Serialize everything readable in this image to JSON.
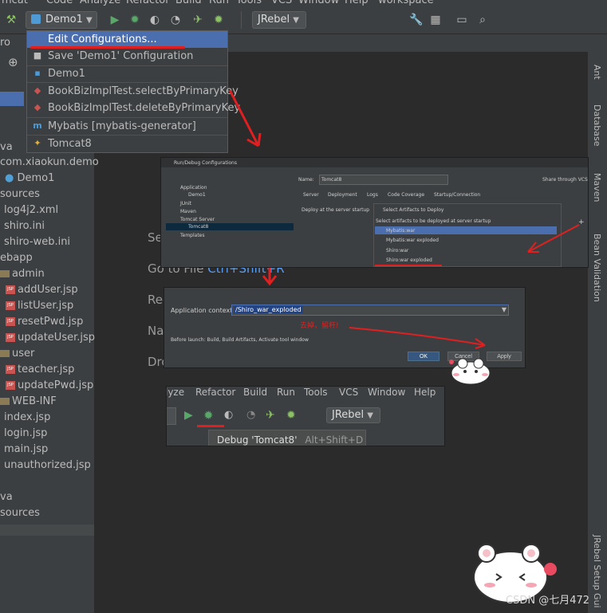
{
  "menubar": {
    "items": [
      "mcat",
      "Code",
      "Analyze",
      "Refactor",
      "Build",
      "Run",
      "Tools",
      "VCS",
      "Window",
      "Help",
      "workspace"
    ]
  },
  "toolbar": {
    "run_config": "Demo1",
    "jrebel": "JRebel"
  },
  "dropdown": {
    "items": [
      {
        "label": "Edit Configurations...",
        "icon": "wrench-icon"
      },
      {
        "label": "Save 'Demo1' Configuration",
        "icon": "save-icon"
      },
      {
        "label": "Demo1",
        "icon": "app-icon"
      },
      {
        "label": "BookBizImplTest.selectByPrimaryKey",
        "icon": "test-icon"
      },
      {
        "label": "BookBizImplTest.deleteByPrimaryKey",
        "icon": "test-icon"
      },
      {
        "label": "Mybatis [mybatis-generator]",
        "icon": "maven-icon"
      },
      {
        "label": "Tomcat8",
        "icon": "tomcat-icon"
      }
    ]
  },
  "sidebar": {
    "header": "ro",
    "items": [
      "va",
      "com.xiaokun.demo",
      "Demo1",
      "sources",
      "log4j2.xml",
      "shiro.ini",
      "shiro-web.ini",
      "ebapp",
      "admin",
      "addUser.jsp",
      "listUser.jsp",
      "resetPwd.jsp",
      "updateUser.jsp",
      "user",
      "teacher.jsp",
      "updatePwd.jsp",
      "WEB-INF",
      "index.jsp",
      "login.jsp",
      "main.jsp",
      "unauthorized.jsp",
      "va",
      "sources"
    ]
  },
  "rightbar": {
    "tools": [
      "Ant",
      "Database",
      "Maven",
      "Bean Validation",
      "JRebel Setup Gui"
    ]
  },
  "welcome": {
    "lines": [
      "Se",
      "Go to File",
      "Rec",
      "Na",
      "Dro"
    ],
    "shortcut": "Ctrl+Shift+R"
  },
  "run_debug_dialog": {
    "title": "Run/Debug Configurations",
    "name_label": "Name:",
    "name_value": "Tomcat8",
    "share_label": "Share through VCS",
    "tree": [
      "Application",
      "Demo1",
      "JUnit",
      "Maven",
      "Tomcat Server",
      "Tomcat8",
      "Templates"
    ],
    "tabs": [
      "Server",
      "Deployment",
      "Logs",
      "Code Coverage",
      "Startup/Connection"
    ],
    "deploy_label": "Deploy at the server startup",
    "artifacts_title": "Select Artifacts to Deploy",
    "artifacts_hint": "Select artifacts to be deployed at server startup",
    "artifacts": [
      "Mybatis:war",
      "Mybatis:war exploded",
      "Shiro:war",
      "Shiro:war exploded"
    ]
  },
  "context_dialog": {
    "label": "Application context:",
    "value": "/Shiro_war_exploded",
    "before_launch": "Before launch: Build, Build Artifacts, Activate tool window",
    "ok": "OK",
    "cancel": "Cancel",
    "apply": "Apply",
    "annotation": "去掉，留杆!"
  },
  "debug_strip": {
    "menu": [
      "lyze",
      "Refactor",
      "Build",
      "Run",
      "Tools",
      "VCS",
      "Window",
      "Help"
    ],
    "jrebel": "JRebel",
    "tooltip": "Debug 'Tomcat8'",
    "tooltip_shortcut": "Alt+Shift+D"
  },
  "watermark": "CSDN @七月472",
  "colors": {
    "accent": "#4b6eaf",
    "annotation": "#e02020",
    "link": "#589df6"
  }
}
